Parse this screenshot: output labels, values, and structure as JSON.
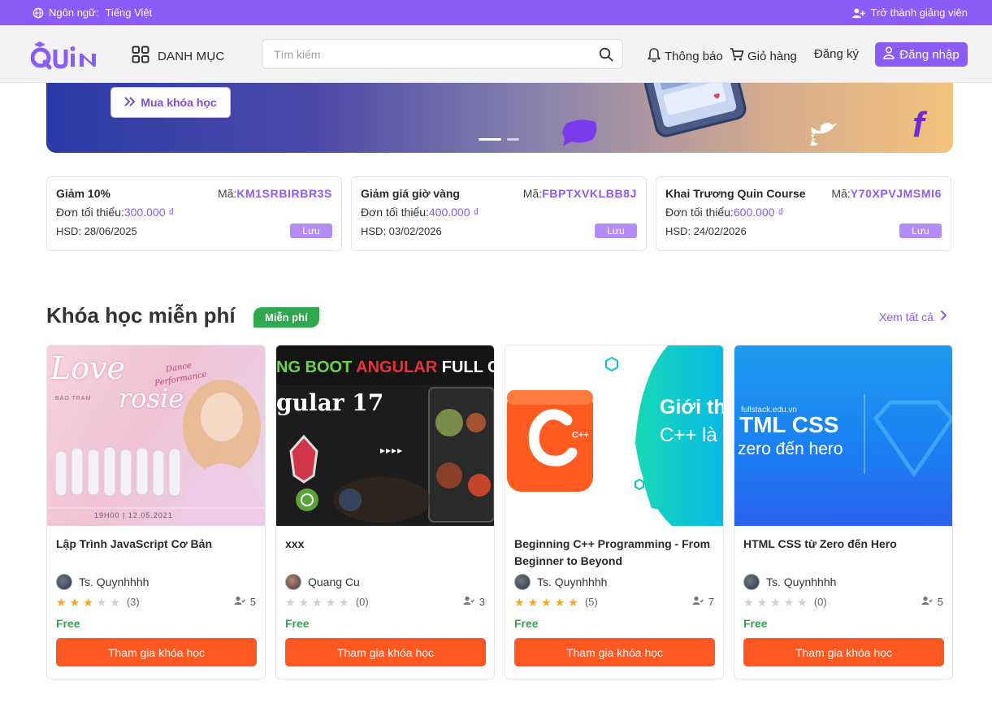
{
  "topbar": {
    "language_label": "Ngôn ngữ:",
    "language_value": "Tiếng Việt",
    "become_teacher": "Trở thành giảng viên"
  },
  "header": {
    "logo_text": "QUIN",
    "category_label": "DANH MỤC",
    "search_placeholder": "Tìm kiếm",
    "notifications_label": "Thông báo",
    "cart_label": "Giỏ hàng",
    "register_label": "Đăng ký",
    "login_label": "Đăng nhập"
  },
  "banner": {
    "buy_label": "Mua khóa học",
    "slides": 2,
    "active_slide": 1
  },
  "coupons": [
    {
      "title": "Giảm 10%",
      "code_label": "Mã:",
      "code": "KM1SRBIRBR3S",
      "min_label": "Đơn tối thiểu:",
      "min_amount": "300.000 ₫",
      "expiry": "HSD: 28/06/2025",
      "save_label": "Lưu"
    },
    {
      "title": "Giảm giá giờ vàng",
      "code_label": "Mã:",
      "code": "FBPTXVKLBB8J",
      "min_label": "Đơn tối thiểu:",
      "min_amount": "400.000 ₫",
      "expiry": "HSD: 03/02/2026",
      "save_label": "Lưu"
    },
    {
      "title": "Khai Trương Quin Course",
      "code_label": "Mã:",
      "code": "Y70XPVJMSMI6",
      "min_label": "Đơn tối thiểu:",
      "min_amount": "600.000 ₫",
      "expiry": "HSD: 24/02/2026",
      "save_label": "Lưu"
    }
  ],
  "section": {
    "title": "Khóa học miễn phí",
    "badge": "Miễn phí",
    "see_all": "Xem tất cả"
  },
  "courses": [
    {
      "title": "Lập Trình JavaScript Cơ Bản",
      "author": "Ts. Quynhhhh",
      "rating": 3,
      "reviews": "(3)",
      "students": "5",
      "price": "Free",
      "cta": "Tham gia khóa học",
      "thumb": {
        "script": "Love",
        "script2": "rosie",
        "sub1": "Dance",
        "sub2": "Performance",
        "small1": "BAO TRAM",
        "footer": "19H00 | 12.05.2021"
      }
    },
    {
      "title": "xxx",
      "author": "Quang Cu",
      "rating": 0,
      "reviews": "(0)",
      "students": "3",
      "price": "Free",
      "cta": "Tham gia khóa học",
      "thumb": {
        "line1a": "NG BOOT",
        "line1b": "ANGULAR",
        "line1c": "FULL COU",
        "line2": "gular 17",
        "arrows": "▸▸▸▸"
      }
    },
    {
      "title": "Beginning C++ Programming - From Beginner to Beyond",
      "author": "Ts. Quynhhhh",
      "rating": 5,
      "reviews": "(5)",
      "students": "7",
      "price": "Free",
      "cta": "Tham gia khóa học",
      "thumb": {
        "text1": "Giới th",
        "text2": "C++ là",
        "badge": "C++"
      }
    },
    {
      "title": "HTML CSS từ Zero đến Hero",
      "author": "Ts. Quynhhhh",
      "rating": 0,
      "reviews": "(0)",
      "students": "5",
      "price": "Free",
      "cta": "Tham gia khóa học",
      "thumb": {
        "site": "fullstack.edu.vn",
        "line1": "TML CSS",
        "line2": "zero đến hero"
      }
    }
  ],
  "colors": {
    "brand": "#8b5cf6",
    "cta": "#ff5722",
    "free": "#2fa84f",
    "star": "#f5a623"
  },
  "icons": [
    "globe-icon",
    "add-user-icon",
    "grid-icon",
    "search-icon",
    "bell-icon",
    "cart-icon",
    "user-icon",
    "double-chevron-icon",
    "chevron-right-icon",
    "students-icon",
    "star-icon"
  ]
}
